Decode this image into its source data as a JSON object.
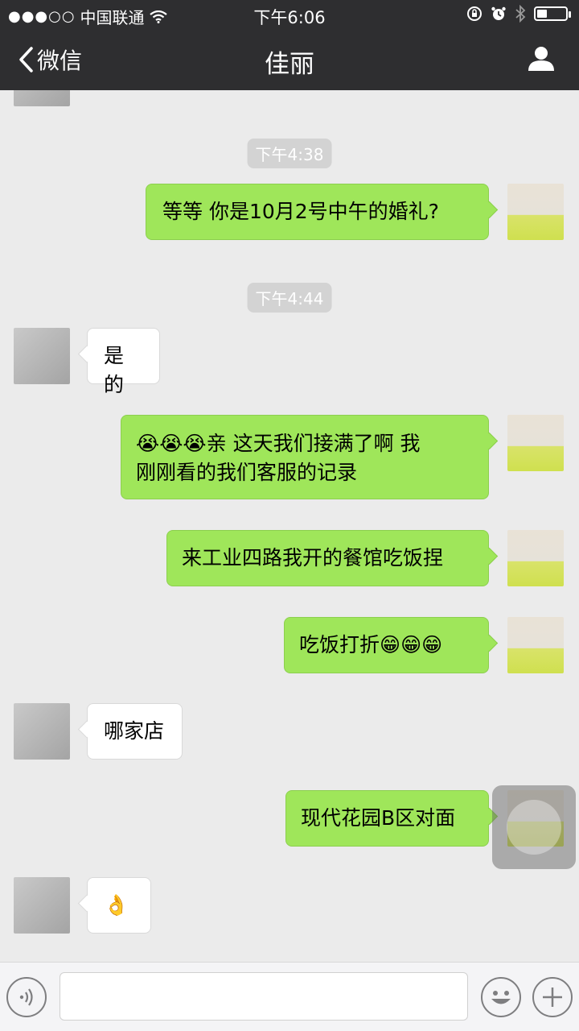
{
  "status_bar": {
    "carrier": "中国联通",
    "time": "下午6:06"
  },
  "nav": {
    "back_label": "微信",
    "title": "佳丽"
  },
  "messages": {
    "ts1": "下午4:38",
    "m1": "等等 你是10月2号中午的婚礼?",
    "ts2": "下午4:44",
    "m2": "是的",
    "m3_emoji": "😭😭😭",
    "m3_line1": "亲 这天我们接满了啊 我",
    "m3_line2": "刚刚看的我们客服的记录",
    "m4": "来工业四路我开的餐馆吃饭捏",
    "m5_text": "吃饭打折",
    "m5_emoji": "😁😁😁",
    "m6": "哪家店",
    "m7": "现代花园B区对面",
    "m8": "👌"
  },
  "input": {
    "value": ""
  },
  "icons": [
    "back-chevron-icon",
    "profile-icon",
    "wifi-icon",
    "signal-icon",
    "alarm-icon",
    "bluetooth-icon",
    "battery-icon",
    "voice-icon",
    "emoji-icon",
    "plus-icon"
  ],
  "colors": {
    "nav_bg": "#2e2e30",
    "bubble_me": "#9fe65a",
    "bubble_them": "#ffffff",
    "chat_bg": "#ebebeb"
  }
}
